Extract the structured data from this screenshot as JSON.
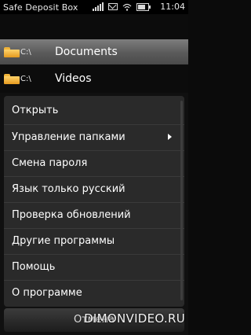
{
  "statusbar": {
    "title": "Safe Deposit Box",
    "time": "11:04",
    "icons": [
      "signal-icon",
      "message-icon",
      "wifi-icon",
      "battery-icon"
    ]
  },
  "files": [
    {
      "drive": "C:\\",
      "name": "Documents",
      "icon": "folder-icon",
      "selected": true
    },
    {
      "drive": "C:\\",
      "name": "Videos",
      "icon": "folder-icon",
      "selected": false
    }
  ],
  "menu": {
    "items": [
      {
        "label": "Открыть",
        "submenu": false
      },
      {
        "label": "Управление папками",
        "submenu": true
      },
      {
        "label": "Смена пароля",
        "submenu": false
      },
      {
        "label": "Язык только русский",
        "submenu": false
      },
      {
        "label": "Проверка обновлений",
        "submenu": false
      },
      {
        "label": "Другие программы",
        "submenu": false
      },
      {
        "label": "Помощь",
        "submenu": false
      },
      {
        "label": "О программе",
        "submenu": false
      }
    ]
  },
  "softkey": {
    "label": "Отмена"
  },
  "watermark": "DIMONVIDEO.RU",
  "colors": {
    "folder": "#f0b43a",
    "menu_bg": "#2a2a2a",
    "selected_row": "#6a6a6a"
  }
}
